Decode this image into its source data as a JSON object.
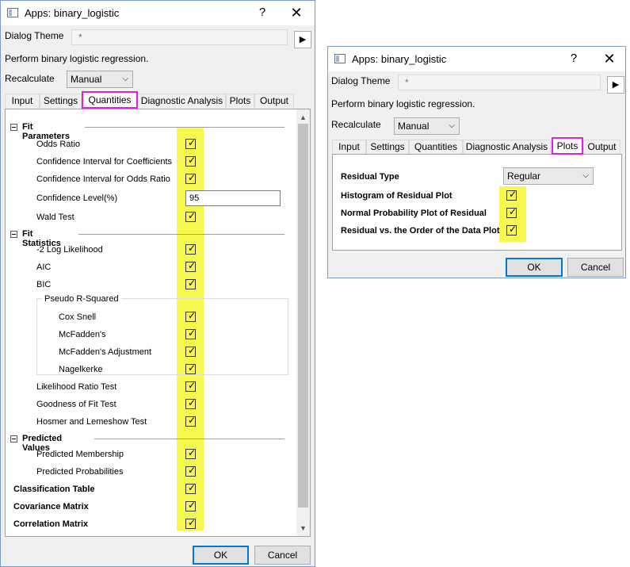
{
  "left_dialog": {
    "title": "Apps: binary_logistic",
    "help": "?",
    "close": "✕",
    "theme_label": "Dialog Theme",
    "theme_value": "*",
    "arrow": "▶",
    "description": "Perform binary logistic regression.",
    "recalc_label": "Recalculate",
    "recalc_value": "Manual",
    "tabs": [
      "Input",
      "Settings",
      "Quantities",
      "Diagnostic Analysis",
      "Plots",
      "Output"
    ],
    "sections": {
      "fit_parameters": "Fit Parameters",
      "fit_statistics": "Fit Statistics",
      "predicted_values": "Predicted Values",
      "pseudo_group": "Pseudo R-Squared"
    },
    "items": {
      "odds_ratio": "Odds Ratio",
      "ci_coef": "Confidence Interval for Coefficients",
      "ci_odds": "Confidence Interval for Odds Ratio",
      "conf_level": "Confidence Level(%)",
      "conf_level_value": "95",
      "wald": "Wald Test",
      "log_lik": "-2 Log Likelihood",
      "aic": "AIC",
      "bic": "BIC",
      "cox_snell": "Cox  Snell",
      "mcfadden": "McFadden's",
      "mcfadden_adj": "McFadden's Adjustment",
      "nagelkerke": "Nagelkerke",
      "lr_test": "Likelihood Ratio Test",
      "gof": "Goodness of Fit Test",
      "hosmer": "Hosmer and Lemeshow Test",
      "pred_membership": "Predicted Membership",
      "pred_prob": "Predicted Probabilities",
      "class_table": "Classification Table",
      "cov_matrix": "Covariance Matrix",
      "corr_matrix": "Correlation Matrix"
    },
    "ok": "OK",
    "cancel": "Cancel"
  },
  "right_dialog": {
    "title": "Apps: binary_logistic",
    "help": "?",
    "close": "✕",
    "theme_label": "Dialog Theme",
    "theme_value": "*",
    "arrow": "▶",
    "description": "Perform binary logistic regression.",
    "recalc_label": "Recalculate",
    "recalc_value": "Manual",
    "tabs": [
      "Input",
      "Settings",
      "Quantities",
      "Diagnostic Analysis",
      "Plots",
      "Output"
    ],
    "residual_type_label": "Residual Type",
    "residual_type_value": "Regular",
    "histogram": "Histogram of Residual Plot",
    "normal_prob": "Normal Probability Plot of Residual",
    "residual_order": "Residual vs. the Order of the Data Plot",
    "ok": "OK",
    "cancel": "Cancel"
  },
  "glyphs": {
    "check": "✓",
    "chevron": "⌵",
    "up": "▲",
    "down": "▼"
  },
  "colors": {
    "tab_highlight": "#e020e0",
    "checkbox_highlight": "#f6f74f",
    "default_button_border": "#0078d7"
  }
}
